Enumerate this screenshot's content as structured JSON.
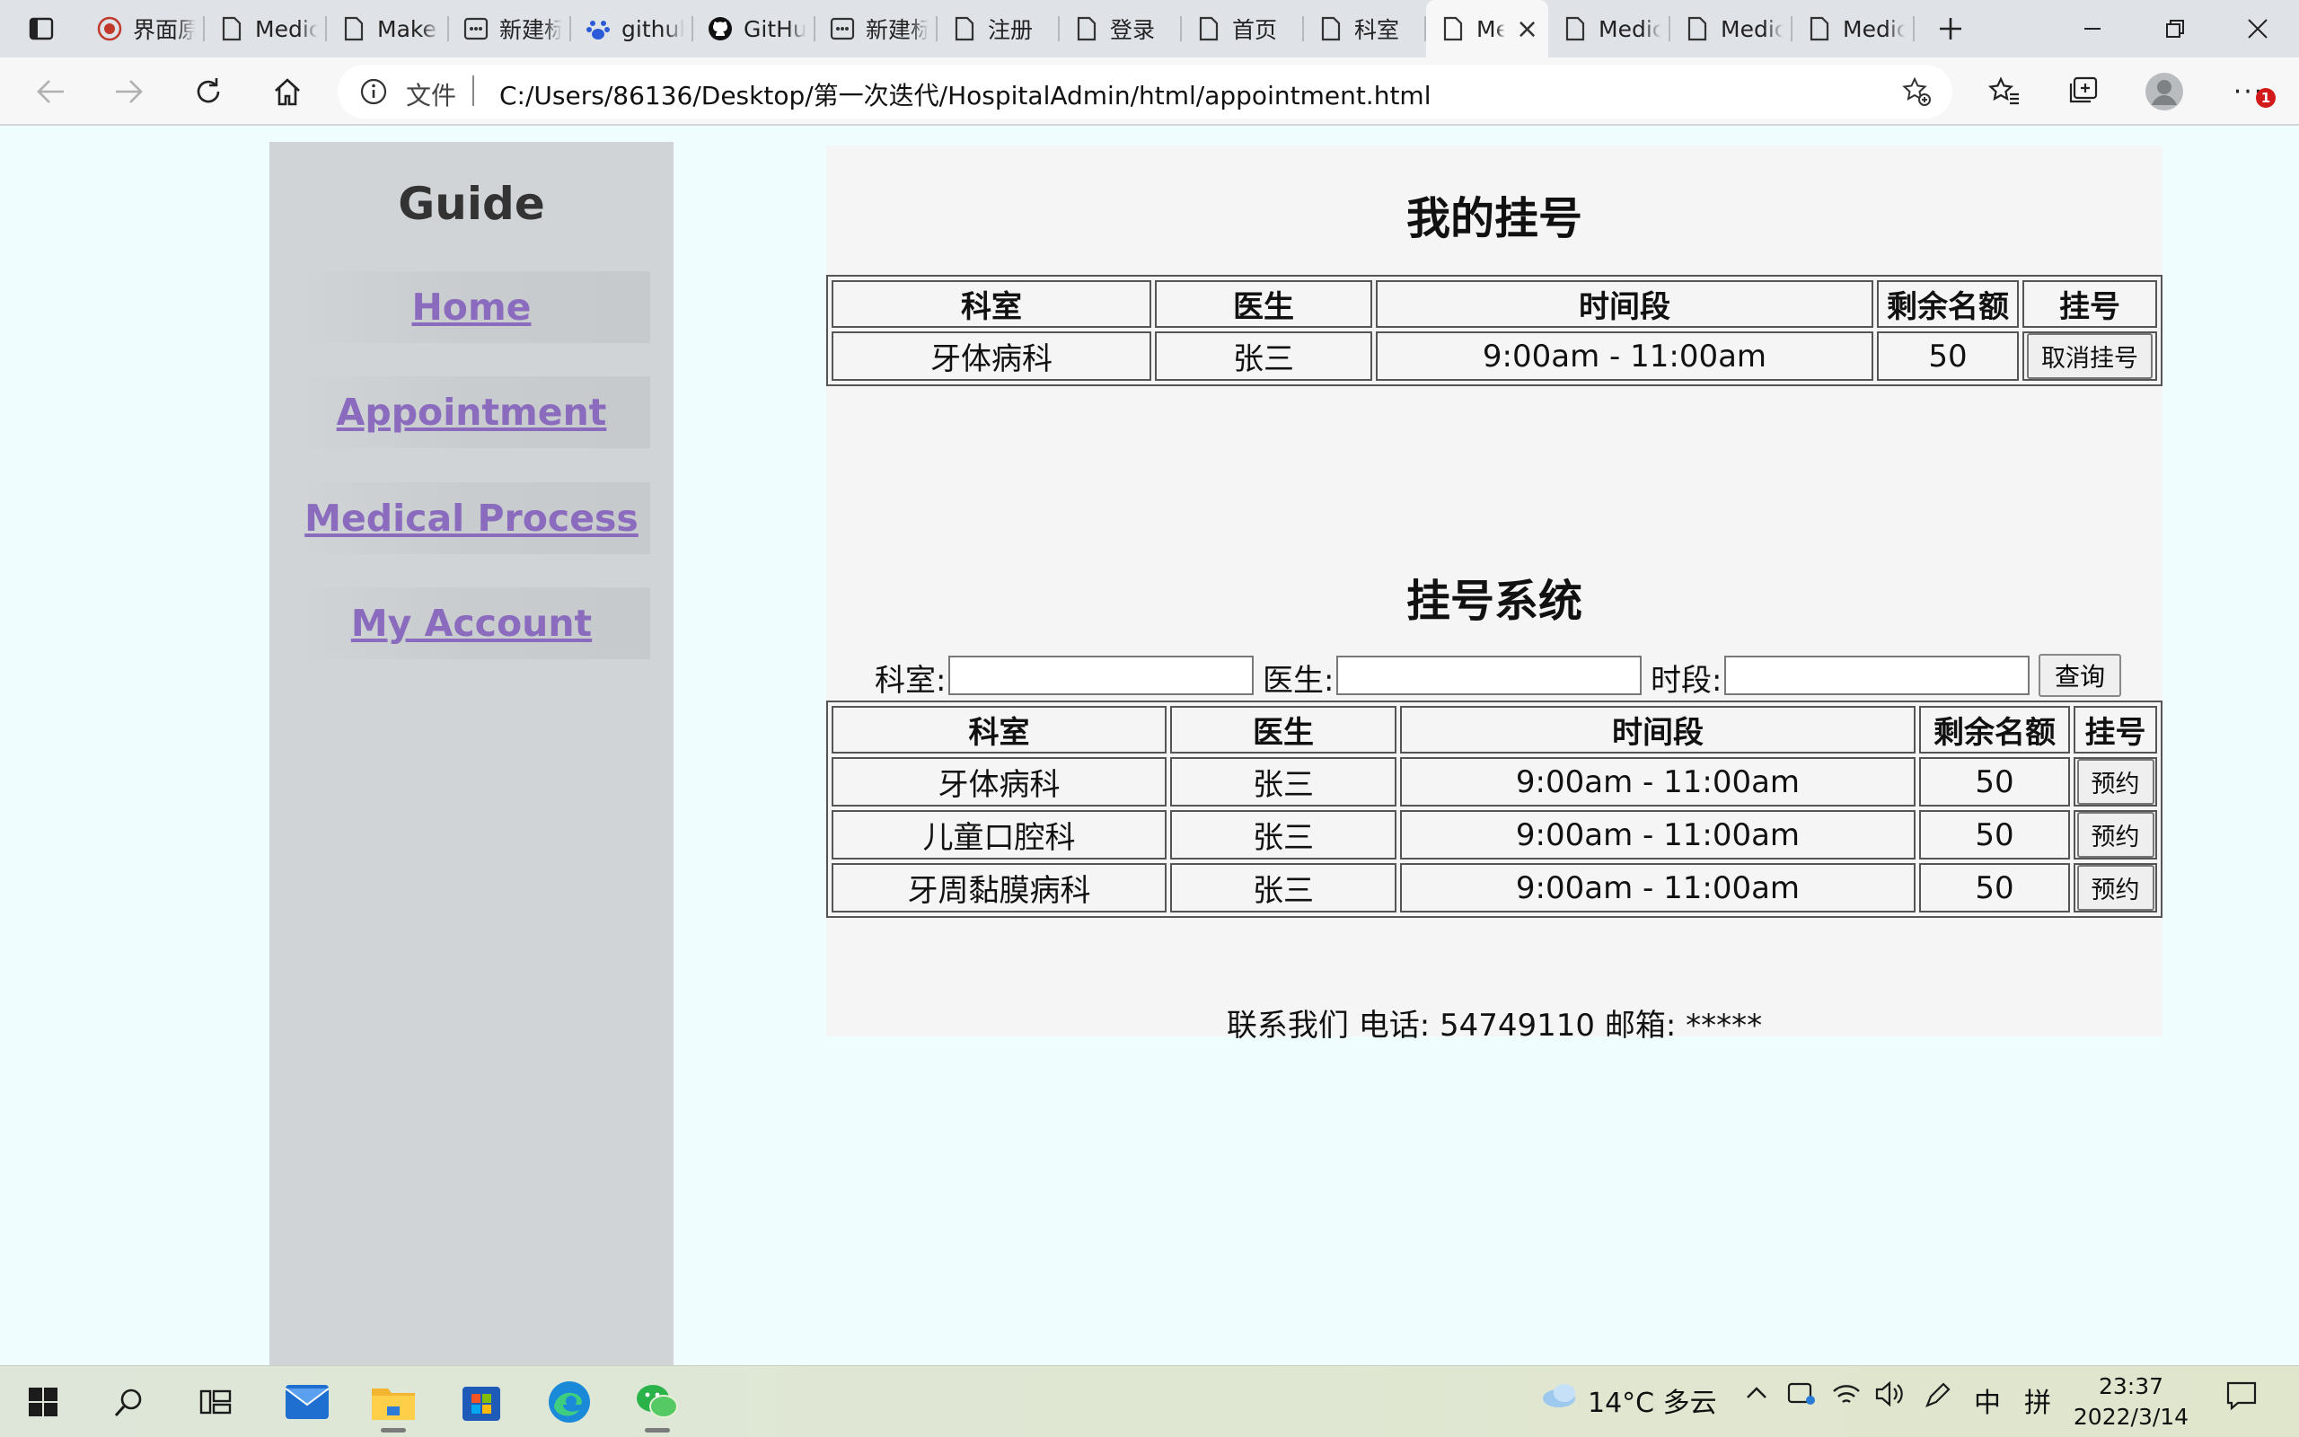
{
  "browser": {
    "tabs": [
      {
        "label": "界面原型",
        "icon": "seal-icon"
      },
      {
        "label": "Medical",
        "icon": "page-icon"
      },
      {
        "label": "Make",
        "icon": "page-icon"
      },
      {
        "label": "新建标签页",
        "icon": "grid-icon"
      },
      {
        "label": "github",
        "icon": "paw-icon"
      },
      {
        "label": "GitHub",
        "icon": "github-icon"
      },
      {
        "label": "新建标签页",
        "icon": "grid-icon"
      },
      {
        "label": "注册",
        "icon": "page-icon"
      },
      {
        "label": "登录",
        "icon": "page-icon"
      },
      {
        "label": "首页",
        "icon": "page-icon"
      },
      {
        "label": "科室",
        "icon": "page-icon"
      },
      {
        "label": "Medical",
        "icon": "page-icon",
        "active": true
      },
      {
        "label": "Medical",
        "icon": "page-icon"
      },
      {
        "label": "Medical",
        "icon": "page-icon"
      },
      {
        "label": "Medical",
        "icon": "page-icon"
      }
    ],
    "address": {
      "protocol_label": "文件",
      "url": "C:/Users/86136/Desktop/第一次迭代/HospitalAdmin/html/appointment.html"
    },
    "notification_badge": "1"
  },
  "sidebar": {
    "title": "Guide",
    "items": [
      {
        "label": "Home"
      },
      {
        "label": "Appointment"
      },
      {
        "label": "Medical Process"
      },
      {
        "label": "My Account"
      }
    ]
  },
  "my_registration": {
    "title": "我的挂号",
    "headers": [
      "科室",
      "医生",
      "时间段",
      "剩余名额",
      "挂号"
    ],
    "rows": [
      {
        "department": "牙体病科",
        "doctor": "张三",
        "time": "9:00am - 11:00am",
        "remaining": "50",
        "action": "取消挂号"
      }
    ]
  },
  "registration_system": {
    "title": "挂号系统",
    "search": {
      "department_label": "科室:",
      "doctor_label": "医生:",
      "period_label": "时段:",
      "department_value": "",
      "doctor_value": "",
      "period_value": "",
      "query_button": "查询"
    },
    "headers": [
      "科室",
      "医生",
      "时间段",
      "剩余名额",
      "挂号"
    ],
    "rows": [
      {
        "department": "牙体病科",
        "doctor": "张三",
        "time": "9:00am - 11:00am",
        "remaining": "50",
        "action": "预约"
      },
      {
        "department": "儿童口腔科",
        "doctor": "张三",
        "time": "9:00am - 11:00am",
        "remaining": "50",
        "action": "预约"
      },
      {
        "department": "牙周黏膜病科",
        "doctor": "张三",
        "time": "9:00am - 11:00am",
        "remaining": "50",
        "action": "预约"
      }
    ]
  },
  "footer": {
    "text": "联系我们 电话: 54749110 邮箱: *****"
  },
  "taskbar": {
    "weather": "14°C 多云",
    "ime_lang": "中",
    "ime_mode": "拼",
    "time": "23:37",
    "date": "2022/3/14"
  }
}
